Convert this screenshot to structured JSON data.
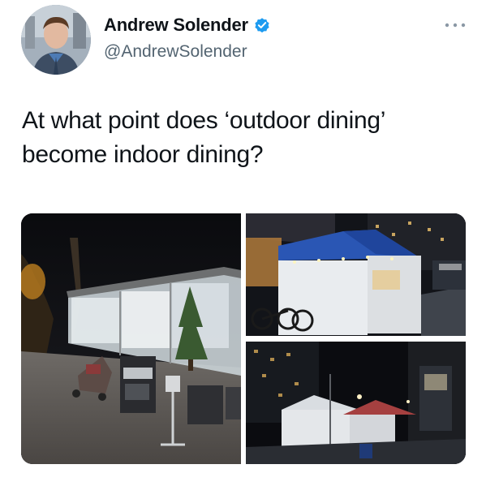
{
  "tweet": {
    "author": {
      "display_name": "Andrew Solender",
      "handle": "@AndrewSolender",
      "verified": true,
      "avatar_icon": "profile-photo"
    },
    "text": "At what point does ‘outdoor dining’ become indoor dining?",
    "more_icon": "ellipsis-icon",
    "media": [
      {
        "kind": "photo",
        "subject": "enclosed outdoor dining structure at night with stroller"
      },
      {
        "kind": "photo",
        "subject": "blue tent over sidewalk dining area at night"
      },
      {
        "kind": "photo",
        "subject": "white tents on dark city street at night"
      }
    ]
  },
  "colors": {
    "text_primary": "#0f1419",
    "text_secondary": "#536471",
    "verified_blue": "#1d9bf0",
    "background": "#ffffff"
  }
}
